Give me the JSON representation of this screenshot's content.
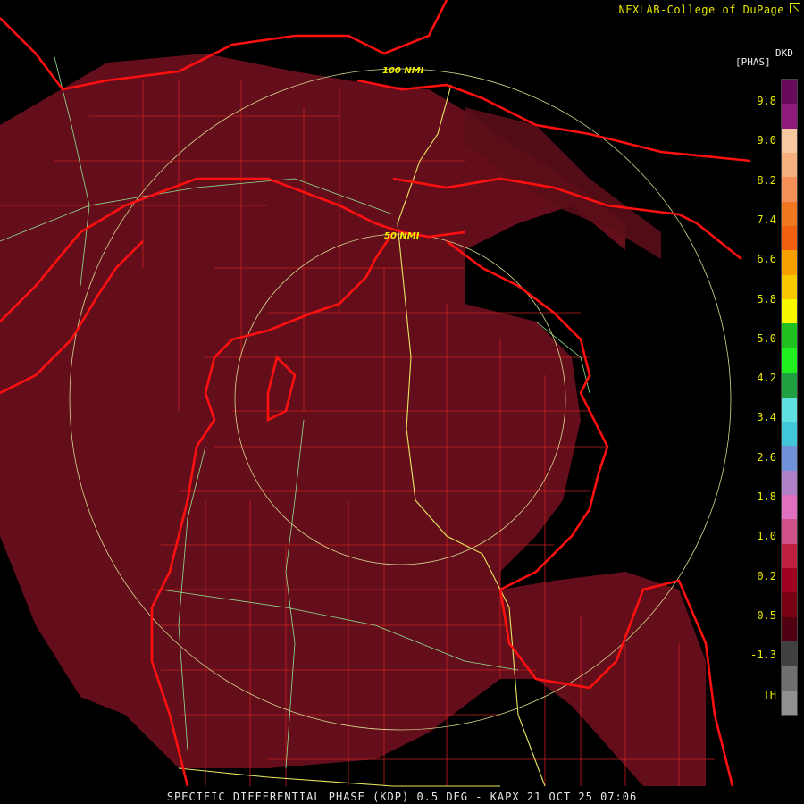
{
  "header": {
    "credit": "NEXLAB-College of DuPage"
  },
  "footer": {
    "caption": "SPECIFIC DIFFERENTIAL PHASE (KDP) 0.5 DEG - KAPX 21 OCT 25 07:06"
  },
  "legend": {
    "unit_top": "DKD",
    "unit_sub": "[PHAS]",
    "labels": [
      "9.8",
      "9.0",
      "8.2",
      "7.4",
      "6.6",
      "5.8",
      "5.0",
      "4.2",
      "3.4",
      "2.6",
      "1.8",
      "1.0",
      "0.2",
      "-0.5",
      "-1.3",
      "TH"
    ],
    "colors": [
      "#6a0a5a",
      "#8e1a7e",
      "#f8c8a0",
      "#f6b080",
      "#f59058",
      "#f07820",
      "#f06010",
      "#f8a000",
      "#f8c800",
      "#f8f800",
      "#20c020",
      "#20f020",
      "#20a040",
      "#60e0e0",
      "#40c8d8",
      "#7090d8",
      "#b080c8",
      "#e070c0",
      "#d05088",
      "#c02040",
      "#a00020",
      "#780010",
      "#500010",
      "#404040",
      "#707070",
      "#909090"
    ]
  },
  "rings": [
    {
      "label": "50 NMI",
      "radius_nmi": 50
    },
    {
      "label": "100 NMI",
      "radius_nmi": 100
    }
  ],
  "colors": {
    "coast": "#ff1010",
    "ring": "#d8d890",
    "county": "#c82020",
    "roads": "#90e090",
    "highway": "#e8e860",
    "echo": "#6a0f1c",
    "ring_label": "#f0f000"
  }
}
